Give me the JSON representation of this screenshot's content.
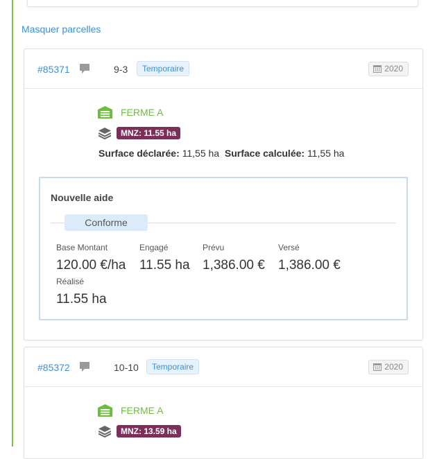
{
  "toggle_label": "Masquer parcelles",
  "colors": {
    "link": "#3b8fd9",
    "farm": "#6cbf3e",
    "mnz_badge": "#7b2f59",
    "side_line": "#7cc14a"
  },
  "parcels": [
    {
      "id": "#85371",
      "number": "9-3",
      "status_tag": "Temporaire",
      "year": "2020",
      "farm": "FERME A",
      "mnz": "MNZ: 11.55 ha",
      "surface_declared_label": "Surface déclarée:",
      "surface_declared_value": "11,55 ha",
      "surface_calculated_label": "Surface calculée:",
      "surface_calculated_value": "11,55 ha",
      "aid": {
        "title": "Nouvelle aide",
        "status": "Conforme",
        "base_label": "Base Montant",
        "base_value": "120.00 €/ha",
        "engaged_label": "Engagé",
        "engaged_value": "11.55 ha",
        "planned_label": "Prévu",
        "planned_value": "1,386.00 €",
        "paid_label": "Versé",
        "paid_value": "1,386.00 €",
        "realized_label": "Réalisé",
        "realized_value": "11.55 ha"
      }
    },
    {
      "id": "#85372",
      "number": "10-10",
      "status_tag": "Temporaire",
      "year": "2020",
      "farm": "FERME A",
      "mnz": "MNZ: 13.59 ha"
    }
  ]
}
